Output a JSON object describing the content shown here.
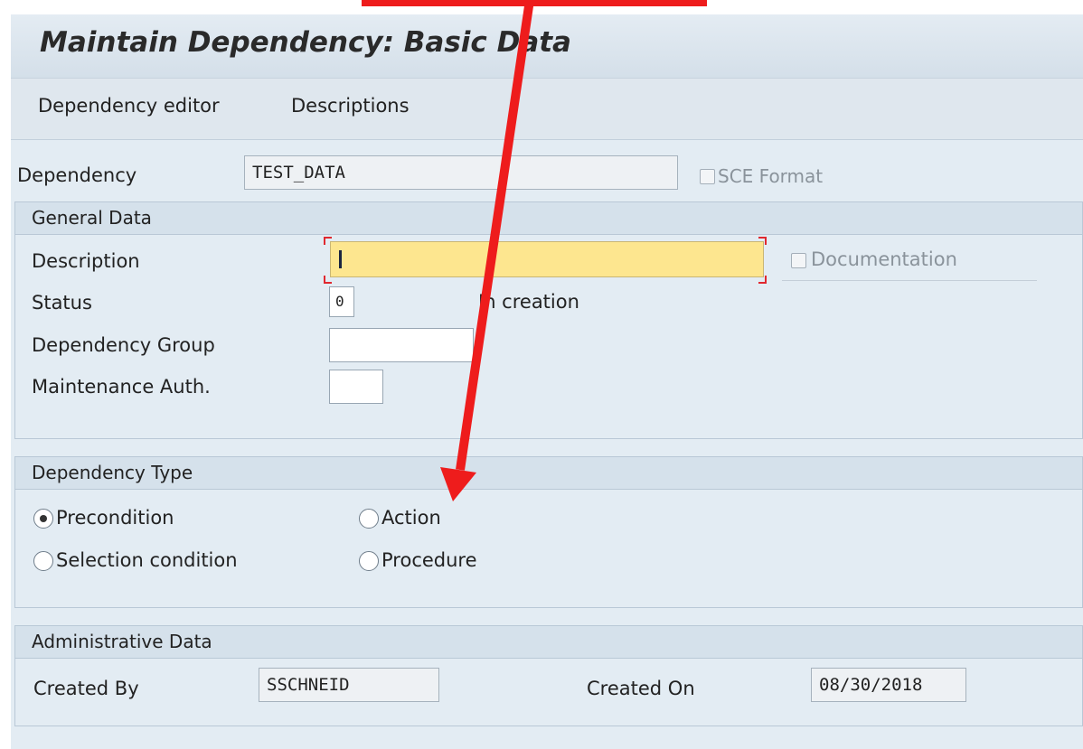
{
  "window": {
    "title": "Maintain Dependency: Basic Data"
  },
  "menu": {
    "items": [
      "Dependency editor",
      "Descriptions"
    ]
  },
  "header": {
    "dependency_label": "Dependency",
    "dependency_value": "TEST_DATA",
    "sce_format_label": "SCE Format",
    "sce_format_checked": false
  },
  "general": {
    "title": "General Data",
    "description_label": "Description",
    "description_value": "",
    "documentation_label": "Documentation",
    "documentation_checked": false,
    "status_label": "Status",
    "status_value": "0",
    "status_text": "In creation",
    "group_label": "Dependency Group",
    "group_value": "",
    "auth_label": "Maintenance Auth.",
    "auth_value": ""
  },
  "type": {
    "title": "Dependency Type",
    "options": [
      "Precondition",
      "Action",
      "Selection condition",
      "Procedure"
    ],
    "selected": "Precondition"
  },
  "admin": {
    "title": "Administrative Data",
    "created_by_label": "Created By",
    "created_by_value": "SSCHNEID",
    "created_on_label": "Created On",
    "created_on_value": "08/30/2018"
  },
  "colors": {
    "required_field": "#fde68f",
    "annotation_arrow": "#ee1c1c",
    "panel_bg": "#e3ecf3"
  }
}
